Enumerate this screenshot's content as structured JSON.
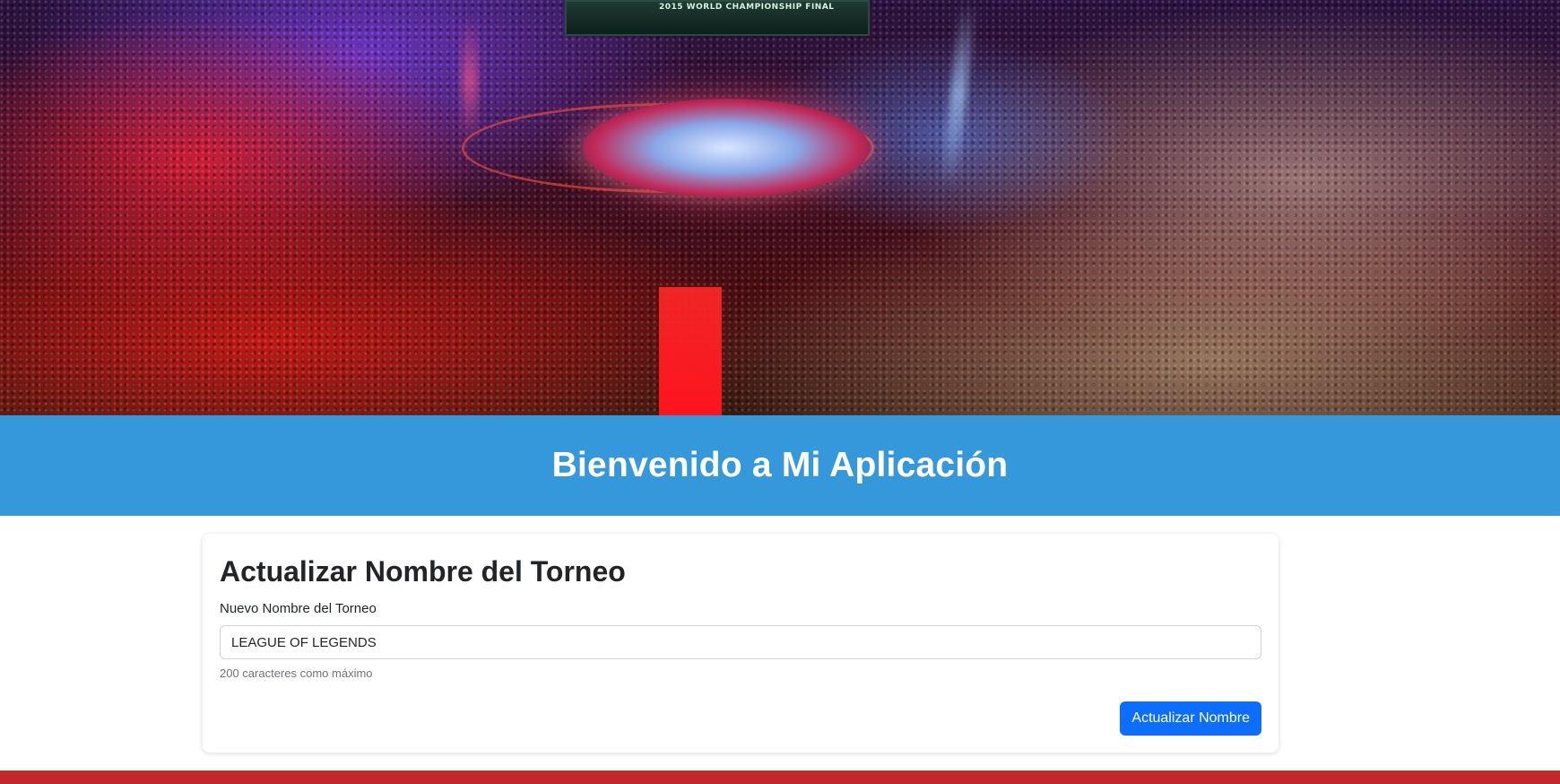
{
  "hero": {
    "image_desc_icon": "arena-crowd-photo",
    "scoreboard_text": "2015 WORLD CHAMPIONSHIP FINAL"
  },
  "banner": {
    "title": "Bienvenido a Mi Aplicación",
    "background_color": "#3598db"
  },
  "form": {
    "heading": "Actualizar Nombre del Torneo",
    "field_label": "Nuevo Nombre del Torneo",
    "field_value": "LEAGUE OF LEGENDS",
    "help_text": "200 caracteres como máximo",
    "submit_label": "Actualizar Nombre",
    "button_color": "#0d6efd"
  },
  "footer": {
    "bar_color": "#c0282c"
  }
}
